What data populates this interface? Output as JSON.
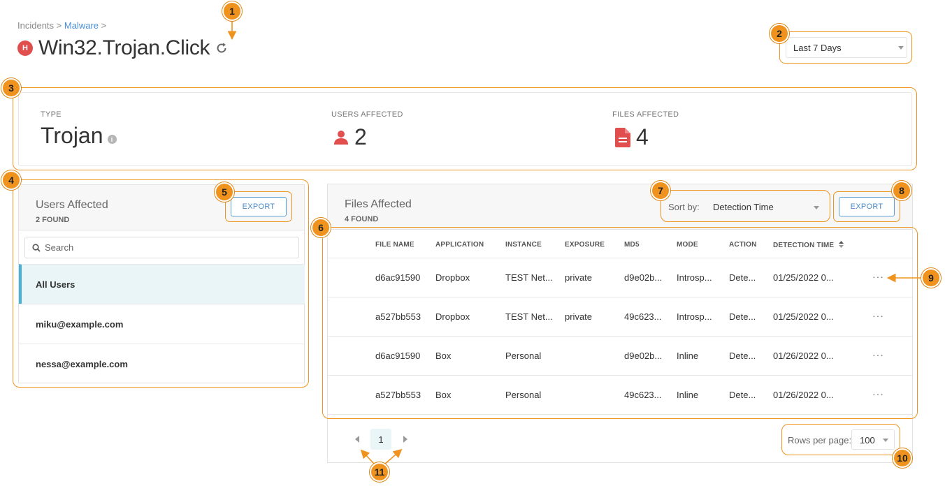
{
  "breadcrumb": {
    "root": "Incidents",
    "sep1": ">",
    "link": "Malware",
    "sep2": ">"
  },
  "header": {
    "severity_badge": "H",
    "title": "Win32.Trojan.Click"
  },
  "date_filter": {
    "value": "Last 7 Days"
  },
  "summary": {
    "type_label": "TYPE",
    "type_value": "Trojan",
    "users_label": "USERS AFFECTED",
    "users_value": "2",
    "files_label": "FILES AFFECTED",
    "files_value": "4"
  },
  "users_panel": {
    "title": "Users Affected",
    "count": "2 FOUND",
    "export_label": "EXPORT",
    "search_placeholder": "Search",
    "items": [
      {
        "label": "All Users"
      },
      {
        "label": "miku@example.com"
      },
      {
        "label": "nessa@example.com"
      }
    ]
  },
  "files_panel": {
    "title": "Files Affected",
    "count": "4 FOUND",
    "export_label": "EXPORT",
    "sort_label": "Sort by:",
    "sort_value": "Detection Time",
    "columns": [
      "FILE NAME",
      "APPLICATION",
      "INSTANCE",
      "EXPOSURE",
      "MD5",
      "MODE",
      "ACTION",
      "DETECTION TIME"
    ],
    "rows": [
      {
        "file_name": "d6ac91590",
        "application": "Dropbox",
        "instance": "TEST Net...",
        "exposure": "private",
        "md5": "d9e02b...",
        "mode": "Introsp...",
        "action": "Dete...",
        "detection_time": "01/25/2022 0..."
      },
      {
        "file_name": "a527bb553",
        "application": "Dropbox",
        "instance": "TEST Net...",
        "exposure": "private",
        "md5": "49c623...",
        "mode": "Introsp...",
        "action": "Dete...",
        "detection_time": "01/25/2022 0..."
      },
      {
        "file_name": "d6ac91590",
        "application": "Box",
        "instance": "Personal",
        "exposure": "",
        "md5": "d9e02b...",
        "mode": "Inline",
        "action": "Dete...",
        "detection_time": "01/26/2022 0..."
      },
      {
        "file_name": "a527bb553",
        "application": "Box",
        "instance": "Personal",
        "exposure": "",
        "md5": "49c623...",
        "mode": "Inline",
        "action": "Dete...",
        "detection_time": "01/26/2022 0..."
      }
    ],
    "row_menu": "···"
  },
  "pagination": {
    "current_page": "1",
    "rows_label": "Rows per page:",
    "rows_value": "100"
  },
  "callouts": [
    "1",
    "2",
    "3",
    "4",
    "5",
    "6",
    "7",
    "8",
    "9",
    "10",
    "11"
  ],
  "colors": {
    "accent_orange": "#f0931e",
    "link_blue": "#4a90d9",
    "danger_red": "#e04e4e",
    "active_row": "#eaf5f7"
  }
}
